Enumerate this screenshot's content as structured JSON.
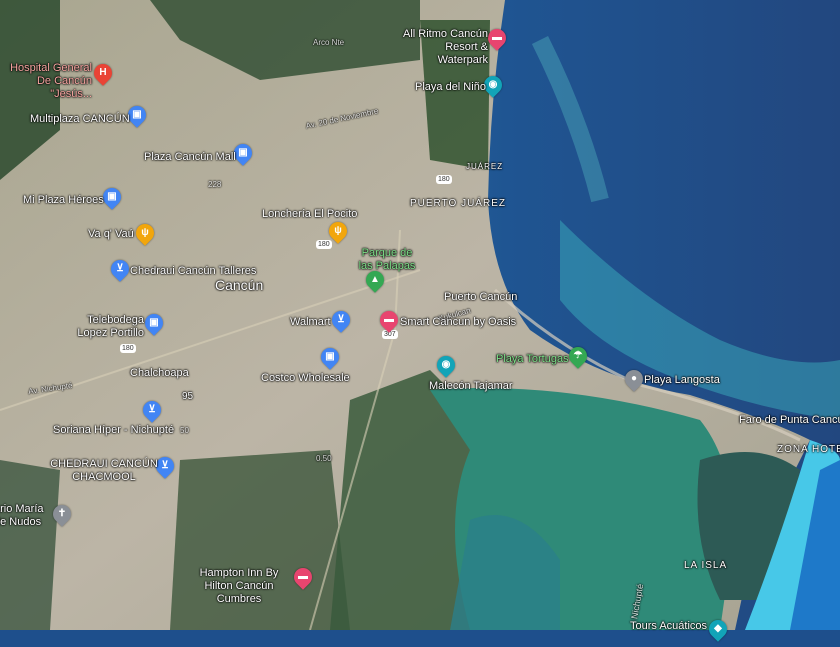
{
  "map": {
    "type": "satellite",
    "colors": {
      "sea_deep": "#1e4f8c",
      "sea_shallow": "#2aa9b8",
      "lagoon": "#2f8a78",
      "land": "#b9b3a3",
      "vegetation": "#2c4a2e",
      "shop_pin": "#4285f4",
      "food_pin": "#f2a60c",
      "hotel_pin": "#e8456f",
      "attraction_pin": "#12a4b8",
      "park_pin": "#34a853",
      "place_pin": "#8a8f96",
      "hospital_pin": "#e94335"
    },
    "places": [
      {
        "name": "Hospital General De Cancún \"Jesús...",
        "icon": "hospital-icon"
      },
      {
        "name": "Multiplaza CANCÚN",
        "icon": "shopping-bag-icon"
      },
      {
        "name": "Plaza Cancún Mall",
        "icon": "shopping-bag-icon"
      },
      {
        "name": "Mi Plaza Héroes",
        "icon": "shopping-bag-icon"
      },
      {
        "name": "Va q' Vaú",
        "icon": "restaurant-icon"
      },
      {
        "name": "Lonchería El Pocito",
        "icon": "restaurant-icon"
      },
      {
        "name": "Chedraui Cancún Talleres",
        "icon": "shopping-cart-icon"
      },
      {
        "name": "Parque de las Palapas",
        "icon": "park-icon"
      },
      {
        "name": "Telebodega Lopez Portillo",
        "icon": "shopping-bag-icon"
      },
      {
        "name": "Walmart",
        "icon": "shopping-cart-icon"
      },
      {
        "name": "Smart Cancun by Oasis",
        "icon": "hotel-icon"
      },
      {
        "name": "Costco Wholesale",
        "icon": "shopping-bag-icon"
      },
      {
        "name": "Soriana Híper - Nichupté",
        "icon": "shopping-cart-icon"
      },
      {
        "name": "CHEDRAUI CANCÚN CHACMOOL",
        "icon": "shopping-cart-icon"
      },
      {
        "name": "ario María de Nudos",
        "icon": "church-icon"
      },
      {
        "name": "Hampton Inn By Hilton Cancún Cumbres",
        "icon": "hotel-icon"
      },
      {
        "name": "All Ritmo Cancún Resort & Waterpark",
        "icon": "hotel-icon"
      },
      {
        "name": "Playa del Niño",
        "icon": "camera-icon"
      },
      {
        "name": "Playa Tortugas",
        "icon": "beach-icon"
      },
      {
        "name": "Malecón Tajamar",
        "icon": "camera-icon"
      },
      {
        "name": "Playa Langosta",
        "icon": "place-icon"
      },
      {
        "name": "Tours Acuáticos",
        "icon": "attraction-icon"
      }
    ],
    "areas": {
      "city": "Cancún",
      "juarez": "JUÁREZ",
      "puerto_juarez": "PUERTO JUÁREZ",
      "puerto_cancun": "Puerto Cancún",
      "chalchoapa": "Chalchoapa",
      "faro": "Faro de Punta Cancún",
      "zona_hotelera": "ZONA HOTE",
      "la_isla": "LA ISLA",
      "nichupte": "Nichupté"
    },
    "roads": {
      "arco_nte": "Arco Nte",
      "av_20_nov": "Av. 20 de Noviembre",
      "av_nichupte": "Av. Nichupté",
      "kukulcan": "Kukulcan",
      "r228": "228",
      "r95": "95",
      "r50": "50",
      "r50b": "0.50",
      "h180": "180",
      "h307": "307"
    }
  }
}
